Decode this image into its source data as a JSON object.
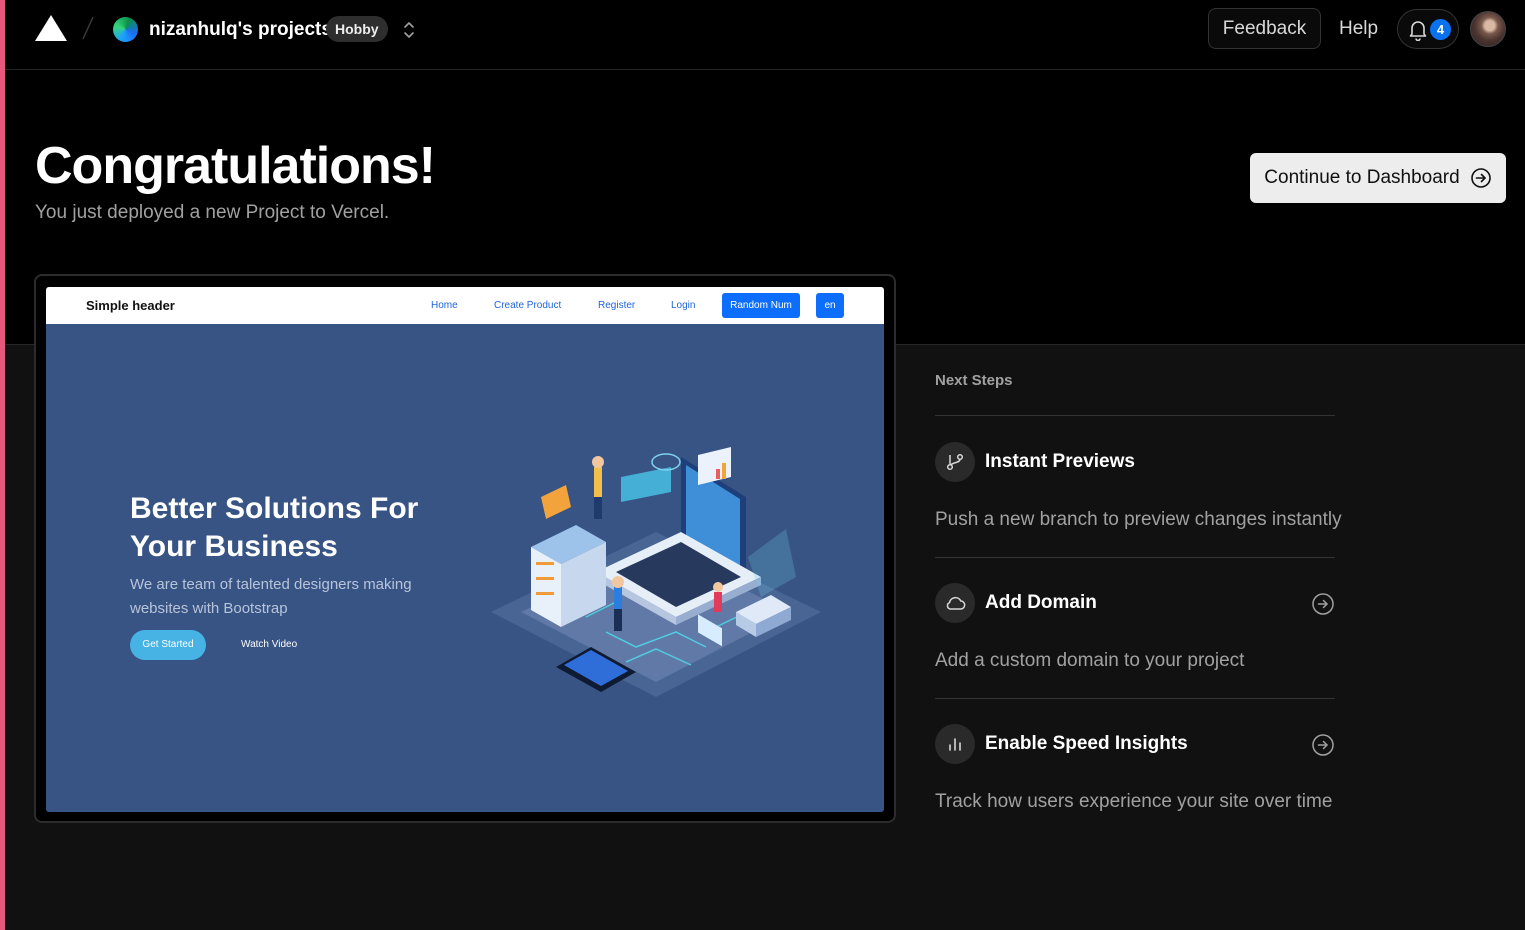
{
  "nav": {
    "team_name": "nizanhulq's projects",
    "plan": "Hobby",
    "feedback": "Feedback",
    "help": "Help",
    "notification_count": "4"
  },
  "hero": {
    "title": "Congratulations!",
    "subtitle": "You just deployed a new Project to Vercel.",
    "cta": "Continue to Dashboard"
  },
  "preview": {
    "brand": "Simple header",
    "nav": [
      "Home",
      "Create Product",
      "Register",
      "Login"
    ],
    "random_button": "Random Num",
    "lang_button": "en",
    "headline": "Better Solutions For Your Business",
    "description": "We are team of talented designers making websites with Bootstrap",
    "primary_cta": "Get Started",
    "secondary_cta": "Watch Video"
  },
  "next_steps": {
    "heading": "Next Steps",
    "items": [
      {
        "title": "Instant Previews",
        "desc": "Push a new branch to preview changes instantly",
        "icon": "git-branch-icon"
      },
      {
        "title": "Add Domain",
        "desc": "Add a custom domain to your project",
        "icon": "cloud-icon"
      },
      {
        "title": "Enable Speed Insights",
        "desc": "Track how users experience your site over time",
        "icon": "bar-chart-icon"
      }
    ]
  },
  "colors": {
    "accent": "#0a72ef",
    "preview_bg": "#375485",
    "preview_button": "#47b2e4"
  }
}
